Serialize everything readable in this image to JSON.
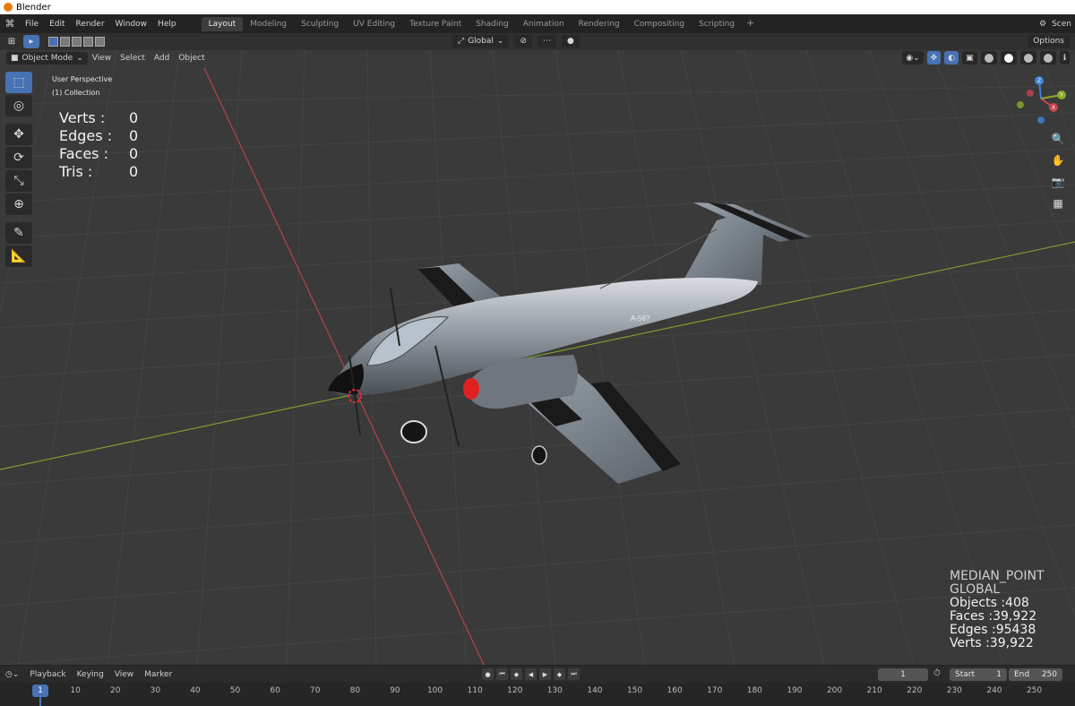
{
  "window": {
    "title": "Blender"
  },
  "topbar": {
    "menus": [
      "File",
      "Edit",
      "Render",
      "Window",
      "Help"
    ],
    "workspaces": [
      "Layout",
      "Modeling",
      "Sculpting",
      "UV Editing",
      "Texture Paint",
      "Shading",
      "Animation",
      "Rendering",
      "Compositing",
      "Scripting"
    ],
    "active_workspace": "Layout",
    "add_label": "+",
    "scene_label": "Scen"
  },
  "toolheader": {
    "transform_orientation": "Global",
    "options_label": "Options"
  },
  "viewport_header": {
    "mode": "Object Mode",
    "menus": [
      "View",
      "Select",
      "Add",
      "Object"
    ]
  },
  "viewport": {
    "perspective": "User Perspective",
    "collection": "(1) Collection",
    "stats": [
      {
        "label": "Verts :",
        "value": "0"
      },
      {
        "label": "Edges :",
        "value": "0"
      },
      {
        "label": "Faces :",
        "value": "0"
      },
      {
        "label": "Tris :",
        "value": "0"
      }
    ],
    "overlay": {
      "pivot": "MEDIAN_POINT",
      "orientation": "GLOBAL",
      "objects": "Objects :408",
      "faces": "Faces :39,922",
      "edges": "Edges :95438",
      "verts": "Verts :39,922"
    },
    "aircraft_tail_text": "A-56?"
  },
  "gizmo": {
    "x": "X",
    "y": "Y",
    "z": "Z"
  },
  "timeline": {
    "menus": [
      "Playback",
      "Keying",
      "View",
      "Marker"
    ],
    "current_frame": "1",
    "start_label": "Start",
    "start_value": "1",
    "end_label": "End",
    "end_value": "250",
    "ruler_ticks": [
      "1",
      "10",
      "20",
      "30",
      "40",
      "50",
      "60",
      "70",
      "80",
      "90",
      "100",
      "110",
      "120",
      "130",
      "140",
      "150",
      "160",
      "170",
      "180",
      "190",
      "200",
      "210",
      "220",
      "230",
      "240",
      "250"
    ]
  },
  "colors": {
    "accent": "#4772b3",
    "x_axis": "#c8444f",
    "y_axis": "#8bab2c",
    "z_axis": "#3f83d8"
  }
}
